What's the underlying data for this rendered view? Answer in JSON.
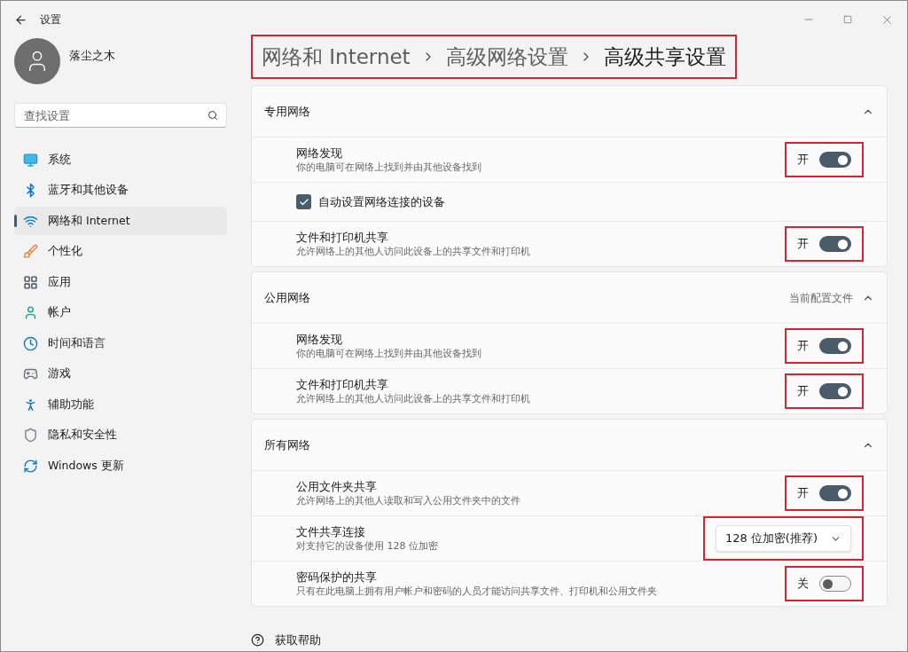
{
  "window": {
    "title": "设置"
  },
  "user": {
    "name": "落尘之木"
  },
  "search": {
    "placeholder": "查找设置"
  },
  "nav": [
    {
      "label": "系统",
      "selected": false
    },
    {
      "label": "蓝牙和其他设备",
      "selected": false
    },
    {
      "label": "网络和 Internet",
      "selected": true
    },
    {
      "label": "个性化",
      "selected": false
    },
    {
      "label": "应用",
      "selected": false
    },
    {
      "label": "帐户",
      "selected": false
    },
    {
      "label": "时间和语言",
      "selected": false
    },
    {
      "label": "游戏",
      "selected": false
    },
    {
      "label": "辅助功能",
      "selected": false
    },
    {
      "label": "隐私和安全性",
      "selected": false
    },
    {
      "label": "Windows 更新",
      "selected": false
    }
  ],
  "breadcrumb": {
    "items": [
      "网络和 Internet",
      "高级网络设置",
      "高级共享设置"
    ],
    "highlighted": true
  },
  "sections": [
    {
      "title": "专用网络",
      "expanded": true,
      "rows": [
        {
          "kind": "toggle",
          "title": "网络发现",
          "description": "你的电脑可在网络上找到并由其他设备找到",
          "on": true,
          "state_label": "开",
          "highlighted": true
        },
        {
          "kind": "checkbox",
          "label": "自动设置网络连接的设备",
          "checked": true
        },
        {
          "kind": "toggle",
          "title": "文件和打印机共享",
          "description": "允许网络上的其他人访问此设备上的共享文件和打印机",
          "on": true,
          "state_label": "开",
          "highlighted": true
        }
      ]
    },
    {
      "title": "公用网络",
      "note": "当前配置文件",
      "expanded": true,
      "rows": [
        {
          "kind": "toggle",
          "title": "网络发现",
          "description": "你的电脑可在网络上找到并由其他设备找到",
          "on": true,
          "state_label": "开",
          "highlighted": true
        },
        {
          "kind": "toggle",
          "title": "文件和打印机共享",
          "description": "允许网络上的其他人访问此设备上的共享文件和打印机",
          "on": true,
          "state_label": "开",
          "highlighted": true
        }
      ]
    },
    {
      "title": "所有网络",
      "expanded": true,
      "rows": [
        {
          "kind": "toggle",
          "title": "公用文件夹共享",
          "description": "允许网络上的其他人读取和写入公用文件夹中的文件",
          "on": true,
          "state_label": "开",
          "highlighted": true
        },
        {
          "kind": "dropdown",
          "title": "文件共享连接",
          "description": "对支持它的设备使用 128 位加密",
          "value": "128 位加密(推荐)",
          "highlighted": true
        },
        {
          "kind": "toggle",
          "title": "密码保护的共享",
          "description": "只有在此电脑上拥有用户帐户和密码的人员才能访问共享文件、打印机和公用文件夹",
          "on": false,
          "state_label": "关",
          "highlighted": true
        }
      ]
    }
  ],
  "help": {
    "label": "获取帮助"
  }
}
